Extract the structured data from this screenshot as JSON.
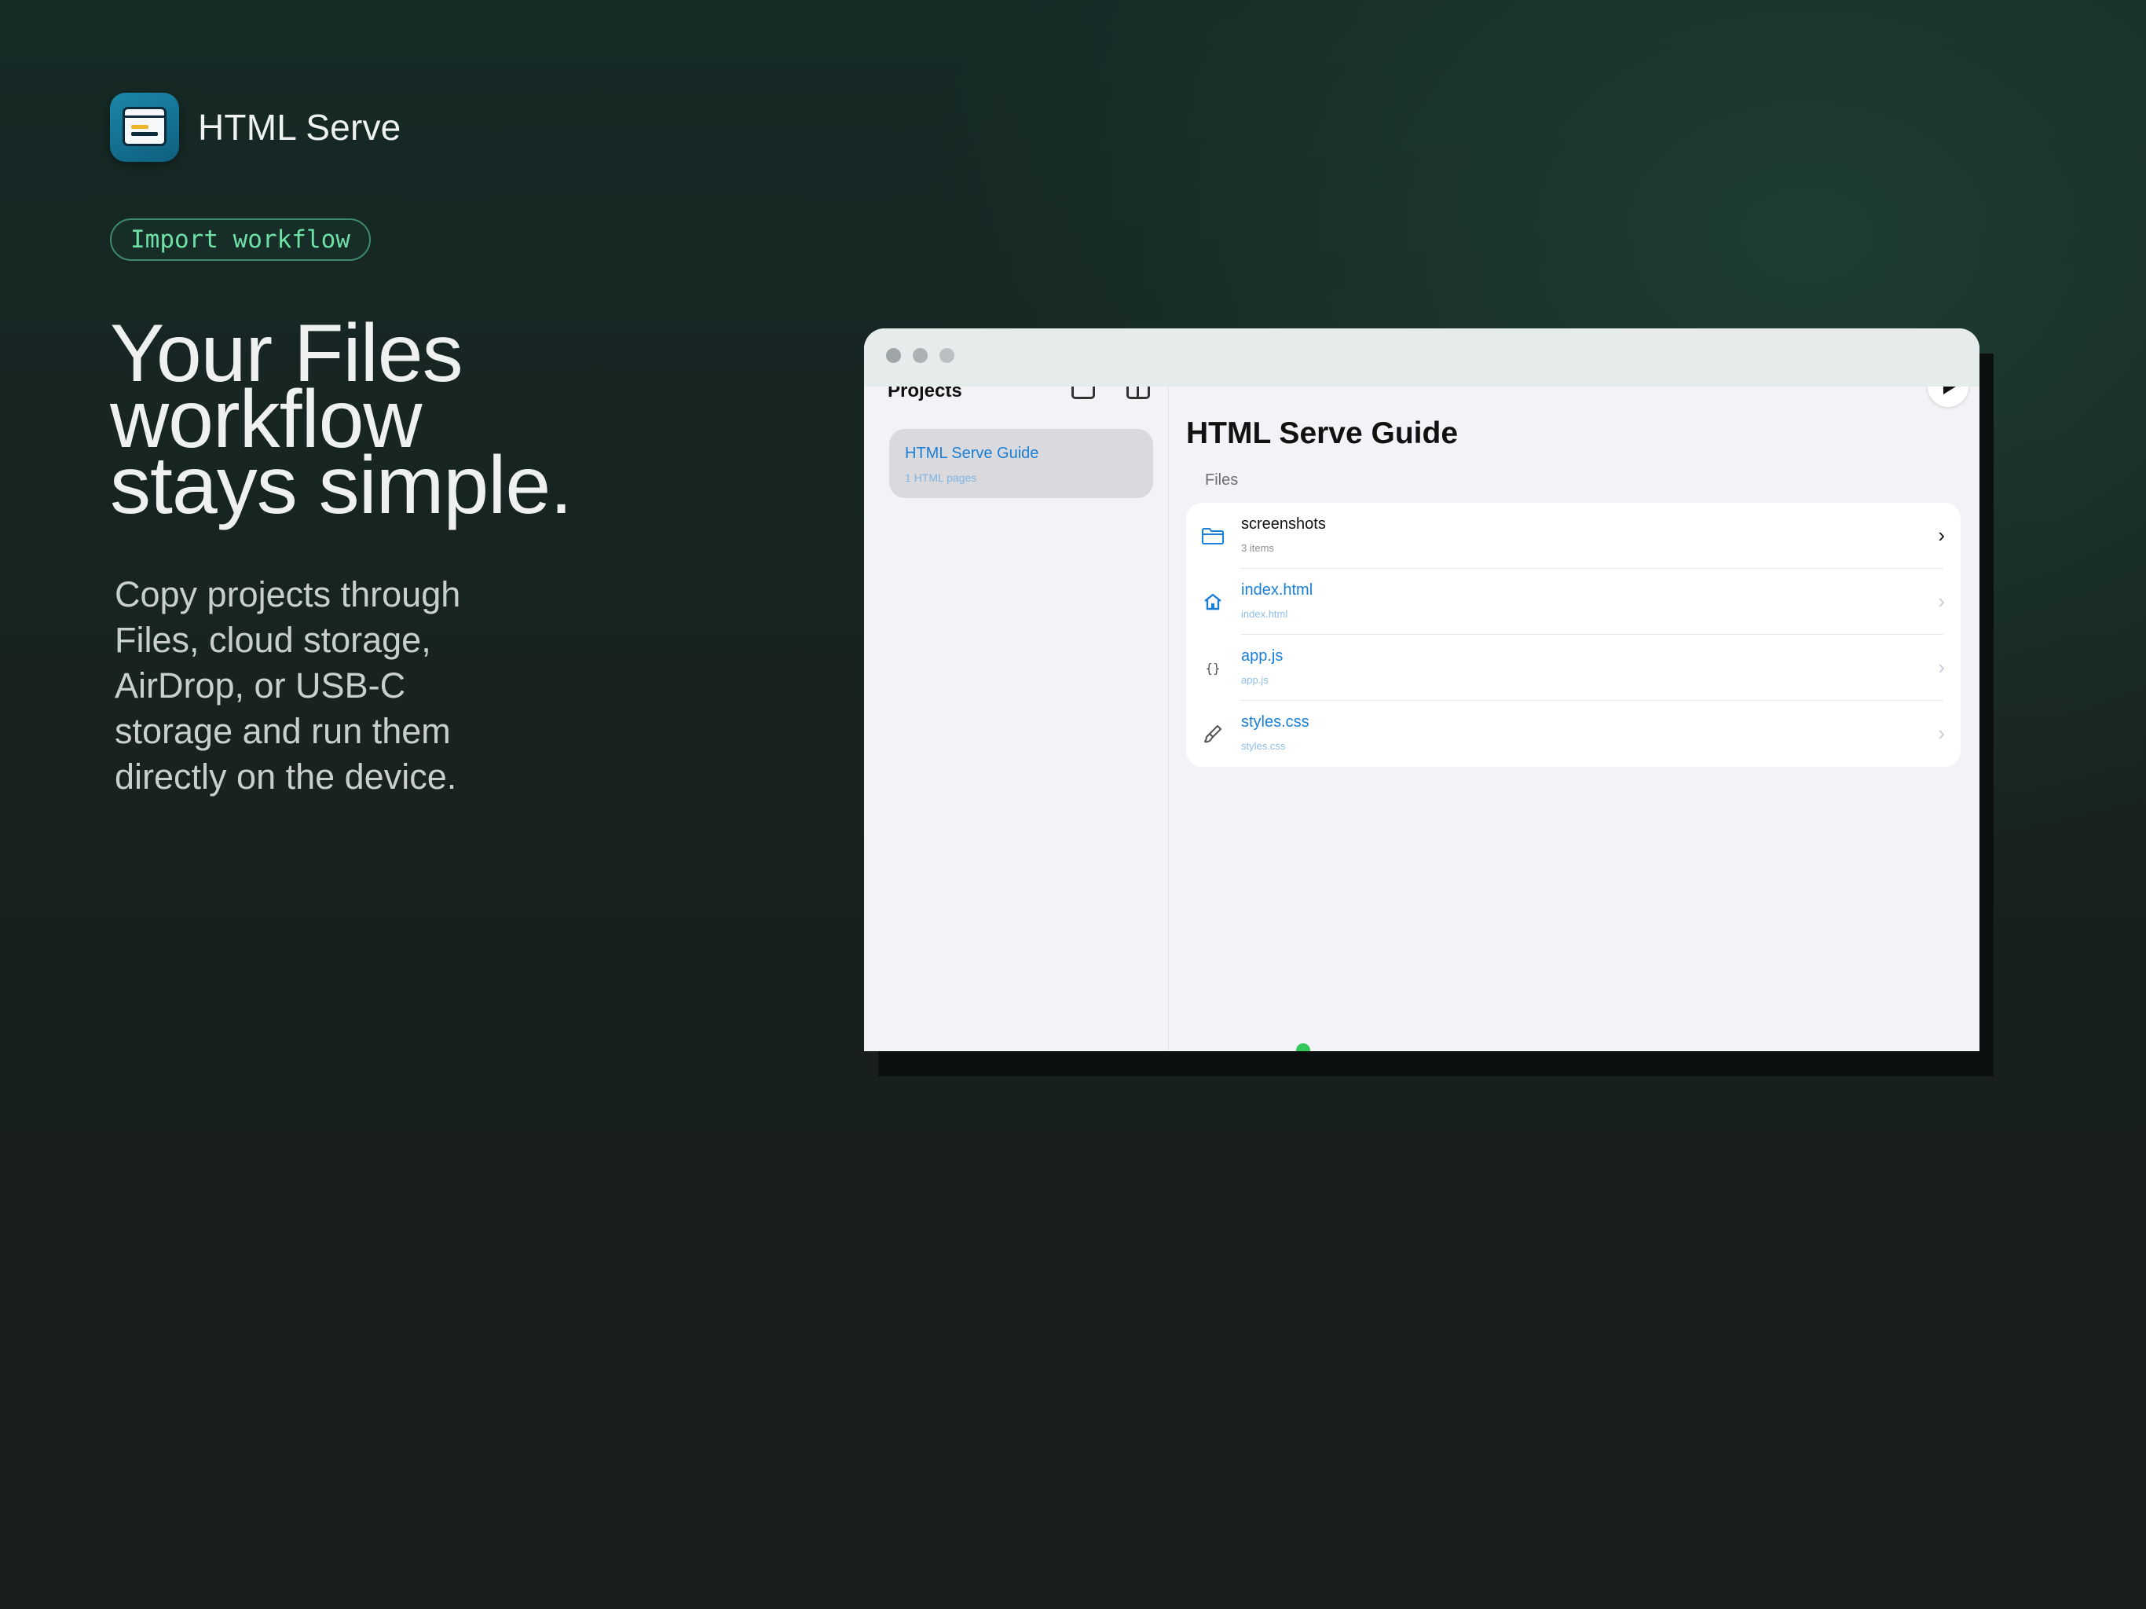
{
  "brand": {
    "name": "HTML Serve",
    "icon": "app-icon"
  },
  "tag": "Import workflow",
  "headline": [
    "Your Files",
    "workflow",
    "stays simple."
  ],
  "description": [
    "Copy projects through",
    "Files, cloud storage,",
    "AirDrop, or USB-C",
    "storage and run them",
    "directly on the device."
  ],
  "window": {
    "sidebar": {
      "title": "Projects",
      "items": [
        {
          "title": "HTML Serve Guide",
          "subtitle": "1 HTML pages"
        }
      ]
    },
    "main": {
      "title": "HTML Serve Guide",
      "section": "Files",
      "files": [
        {
          "name": "screenshots",
          "subtitle": "3 items",
          "icon": "folder-icon"
        },
        {
          "name": "index.html",
          "subtitle": "index.html",
          "icon": "home-icon"
        },
        {
          "name": "app.js",
          "subtitle": "app.js",
          "icon": "braces-icon"
        },
        {
          "name": "styles.css",
          "subtitle": "styles.css",
          "icon": "brush-icon"
        }
      ]
    }
  },
  "colors": {
    "accent": "#1a7fd6",
    "tag_text": "#6fe0a6",
    "status": "#34c759"
  }
}
